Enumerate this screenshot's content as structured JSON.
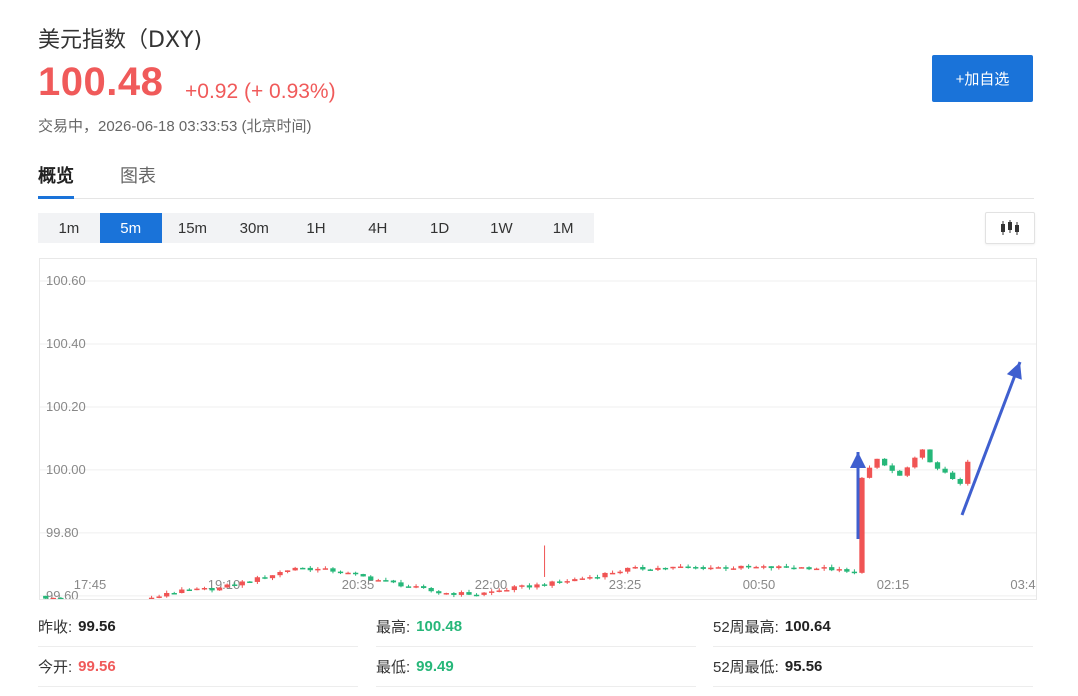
{
  "header": {
    "title": "美元指数（DXY)",
    "price": "100.48",
    "change": "+0.92 (+ 0.93%)",
    "status": "交易中，2026-06-18 03:33:53 (北京时间)",
    "add_label": "+加自选"
  },
  "tabs": [
    {
      "label": "概览",
      "active": true
    },
    {
      "label": "图表",
      "active": false
    }
  ],
  "periods": [
    "1m",
    "5m",
    "15m",
    "30m",
    "1H",
    "4H",
    "1D",
    "1W",
    "1M"
  ],
  "active_period": "5m",
  "chart_type_icon": "candlestick-icon",
  "colors": {
    "up": "#f05454",
    "down": "#26b779",
    "accent": "#1a73d9",
    "arrow": "#3f5fcf"
  },
  "stats": [
    {
      "label": "昨收:",
      "value": "99.56",
      "color": "#222"
    },
    {
      "label": "最高:",
      "value": "100.48",
      "color": "#26b779"
    },
    {
      "label": "52周最高:",
      "value": "100.64",
      "color": "#222"
    },
    {
      "label": "今开:",
      "value": "99.56",
      "color": "#f05a5a"
    },
    {
      "label": "最低:",
      "value": "99.49",
      "color": "#26b779"
    },
    {
      "label": "52周最低:",
      "value": "95.56",
      "color": "#222"
    }
  ],
  "chart_data": {
    "type": "candlestick",
    "y_ticks": [
      "100.60",
      "100.40",
      "100.20",
      "100.00",
      "99.80",
      "99.60"
    ],
    "y_tick_values": [
      100.6,
      100.4,
      100.2,
      100.0,
      99.8,
      99.6
    ],
    "x_ticks": [
      "17:45",
      "19:10",
      "20:35",
      "22:00",
      "23:25",
      "00:50",
      "02:15",
      "03:4"
    ],
    "ylim": [
      99.59,
      100.67
    ],
    "candles_count": 123,
    "grid": true,
    "annotations": [
      "up-arrow",
      "up-arrow"
    ]
  }
}
